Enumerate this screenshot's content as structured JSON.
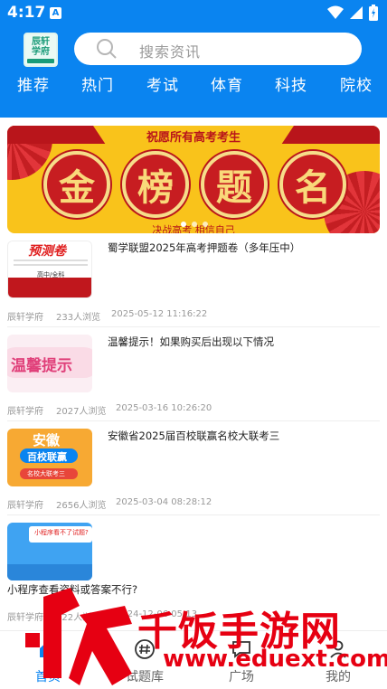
{
  "status_bar": {
    "time": "4:17",
    "app_badge": "A"
  },
  "header": {
    "logo_text": "辰轩学府",
    "search_placeholder": "搜索资讯",
    "tabs": [
      "推荐",
      "热门",
      "考试",
      "体育",
      "科技",
      "院校"
    ]
  },
  "banner": {
    "subtitle": "祝愿所有高考考生",
    "characters": [
      "金",
      "榜",
      "题",
      "名"
    ],
    "footer": "决战高考  相信自己",
    "page_count": 3,
    "active_index": 0
  },
  "articles": [
    {
      "title": "蜀学联盟2025年高考押题卷（多年压中）",
      "source": "辰轩学府",
      "views": "233人浏览",
      "date": "2025-05-12 11:16:22",
      "thumb_text": "预测卷",
      "thumb_sub": "高中/全科"
    },
    {
      "title": "温馨提示！如果购买后出现以下情况",
      "source": "辰轩学府",
      "views": "2027人浏览",
      "date": "2025-03-16 10:26:20",
      "thumb_text": "温馨提示"
    },
    {
      "title": "安徽省2025届百校联赢名校大联考三",
      "source": "辰轩学府",
      "views": "2656人浏览",
      "date": "2025-03-04 08:28:12",
      "thumb_text": "安徽",
      "thumb_sub": "百校联赢",
      "thumb_sub2": "名校大联考三"
    },
    {
      "title": "小程序查看资料或答案不行?",
      "source": "辰轩学府",
      "views": "822人浏览",
      "date": "2024-12-06 05:13",
      "thumb_text": "小程序看不了试题?"
    }
  ],
  "bottom_nav": [
    "首页",
    "试题库",
    "广场",
    "我的"
  ],
  "watermark": {
    "text": "千饭手游网",
    "url": "www.eduext.com"
  },
  "colors": {
    "primary": "#0a84f0",
    "banner_red": "#b9151b",
    "banner_gold": "#f9c31b",
    "watermark": "#e60012"
  }
}
